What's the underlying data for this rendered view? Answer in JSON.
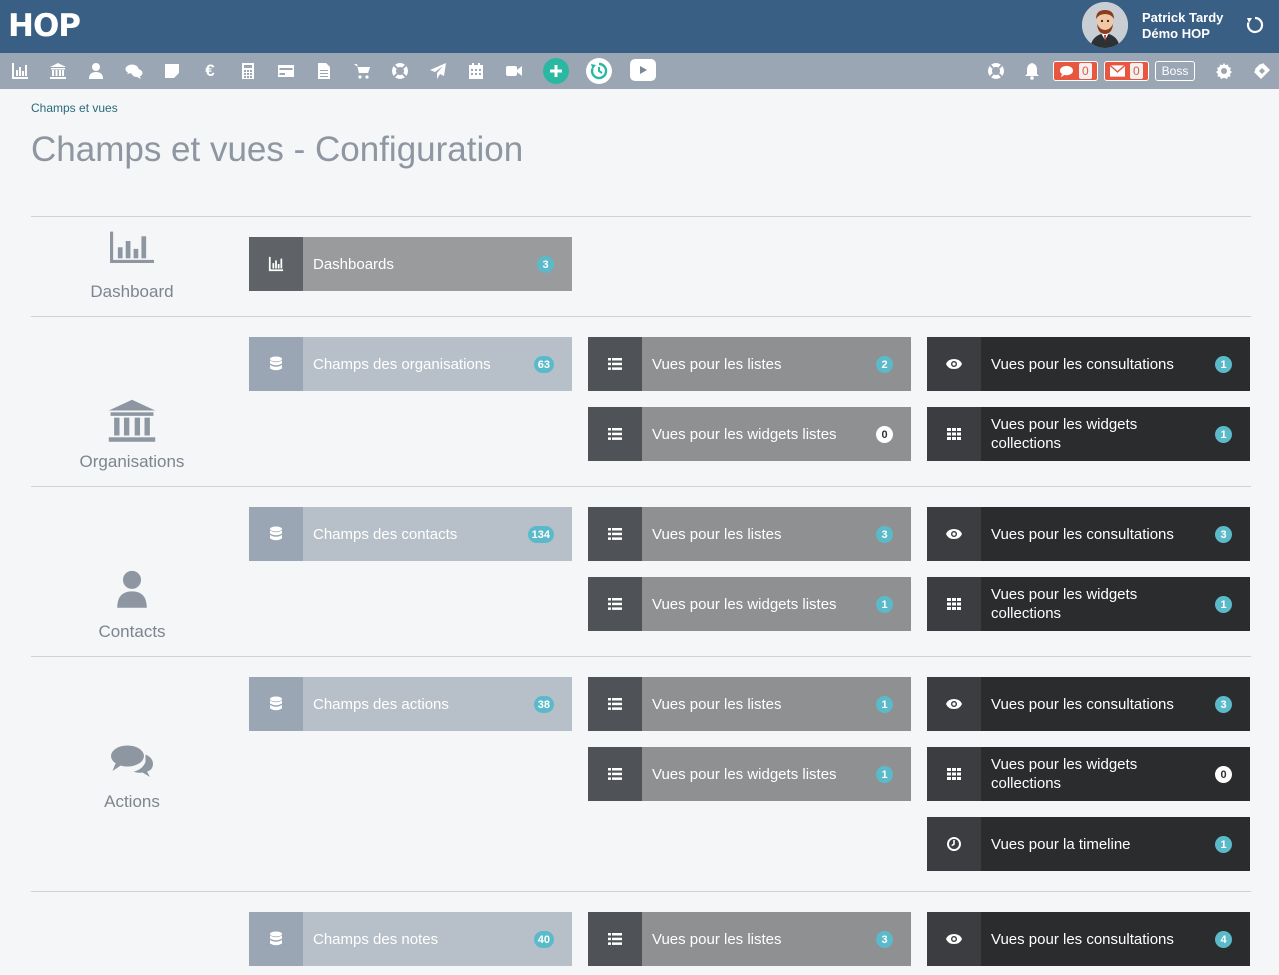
{
  "header": {
    "logo": "HOP",
    "user_name": "Patrick Tardy",
    "user_org": "Démo HOP"
  },
  "toolbar": {
    "icons": [
      "chart-icon",
      "bank-icon",
      "user-icon",
      "chat-icon",
      "note-icon",
      "euro-icon",
      "calculator-icon",
      "credit-card-icon",
      "document-icon",
      "cart-icon",
      "lifebuoy-icon",
      "send-icon",
      "calendar-icon",
      "video-icon"
    ],
    "messages_count": "0",
    "mail_count": "0",
    "boss_label": "Boss"
  },
  "breadcrumb": "Champs et vues",
  "page_title": "Champs et vues - Configuration",
  "sections": {
    "dashboard": {
      "label": "Dashboard",
      "dashboards": {
        "label": "Dashboards",
        "count": "3"
      }
    },
    "organisations": {
      "label": "Organisations",
      "fields": {
        "label": "Champs des organisations",
        "count": "63"
      },
      "lists": {
        "label": "Vues pour les listes",
        "count": "2"
      },
      "consult": {
        "label": "Vues pour les consultations",
        "count": "1"
      },
      "widget_lists": {
        "label": "Vues pour les widgets listes",
        "count": "0"
      },
      "widget_collections": {
        "label": "Vues pour les widgets collections",
        "count": "1"
      }
    },
    "contacts": {
      "label": "Contacts",
      "fields": {
        "label": "Champs des contacts",
        "count": "134"
      },
      "lists": {
        "label": "Vues pour les listes",
        "count": "3"
      },
      "consult": {
        "label": "Vues pour les consultations",
        "count": "3"
      },
      "widget_lists": {
        "label": "Vues pour les widgets listes",
        "count": "1"
      },
      "widget_collections": {
        "label": "Vues pour les widgets collections",
        "count": "1"
      }
    },
    "actions": {
      "label": "Actions",
      "fields": {
        "label": "Champs des actions",
        "count": "38"
      },
      "lists": {
        "label": "Vues pour les listes",
        "count": "1"
      },
      "consult": {
        "label": "Vues pour les consultations",
        "count": "3"
      },
      "widget_lists": {
        "label": "Vues pour les widgets listes",
        "count": "1"
      },
      "widget_collections": {
        "label": "Vues pour les widgets collections",
        "count": "0"
      },
      "timeline": {
        "label": "Vues pour la timeline",
        "count": "1"
      }
    },
    "notes": {
      "fields": {
        "label": "Champs des notes",
        "count": "40"
      },
      "lists": {
        "label": "Vues pour les listes",
        "count": "3"
      },
      "consult": {
        "label": "Vues pour les consultations",
        "count": "4"
      }
    }
  },
  "colors": {
    "header": "#3a5f84",
    "toolbar": "#9aa6b3",
    "badge_teal": "#5bbac9",
    "counter_red": "#e8563f",
    "accent_green": "#2bb8a2"
  }
}
